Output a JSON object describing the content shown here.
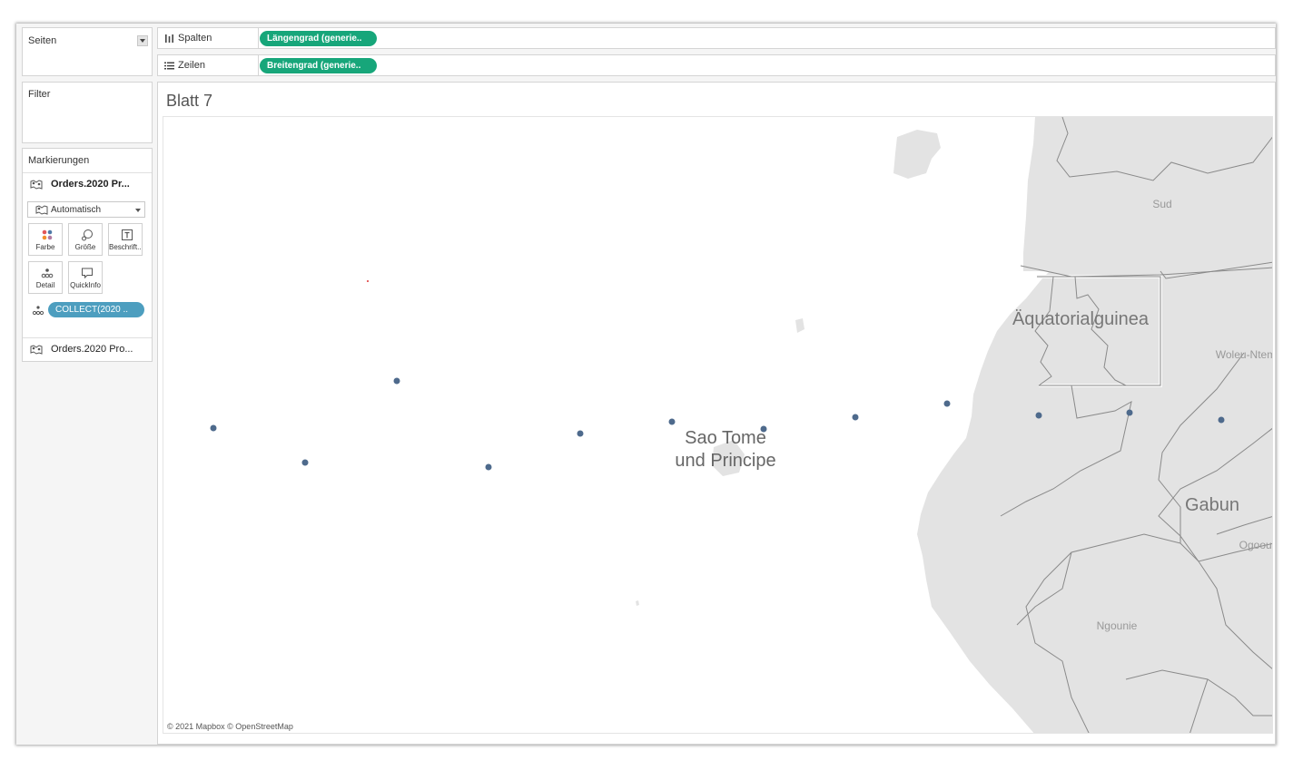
{
  "left_pane": {
    "pages": {
      "title": "Seiten"
    },
    "filters": {
      "title": "Filter"
    },
    "marks": {
      "title": "Markierungen",
      "datasource_primary": "Orders.2020 Pr...",
      "mark_type": "Automatisch",
      "buttons": [
        {
          "label": "Farbe",
          "icon": "color-icon"
        },
        {
          "label": "Größe",
          "icon": "size-icon"
        },
        {
          "label": "Beschrift...",
          "icon": "label-icon"
        },
        {
          "label": "Detail",
          "icon": "detail-icon"
        },
        {
          "label": "QuickInfo",
          "icon": "tooltip-icon"
        }
      ],
      "detail_pill": "COLLECT(2020 ..",
      "datasource_secondary": "Orders.2020 Pro..."
    }
  },
  "shelves": {
    "columns": {
      "name": "Spalten",
      "pill": "Längengrad (generie.."
    },
    "rows": {
      "name": "Zeilen",
      "pill": "Breitengrad (generie.."
    }
  },
  "sheet": {
    "title": "Blatt 7",
    "map_labels": {
      "sao_tome_line1": "Sao Tome",
      "sao_tome_line2": "und Principe",
      "equatorial_guinea": "Äquatorialguinea",
      "gabon": "Gabun",
      "sud": "Sud",
      "woleu_ntem": "Woleu-Ntem",
      "ogooue": "Ogooué",
      "ngounie": "Ngounie"
    },
    "attribution": "© 2021 Mapbox © OpenStreetMap",
    "points_color": "#4e6a8c"
  },
  "colors": {
    "accent_green": "#17a67a",
    "pill_blue": "#4d9ebf",
    "land": "#e3e3e3",
    "water": "#ffffff"
  }
}
